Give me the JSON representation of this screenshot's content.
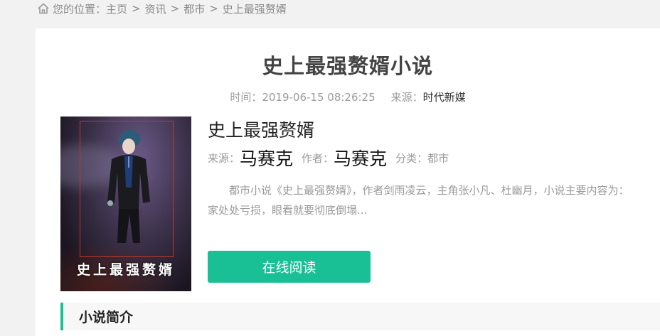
{
  "breadcrumb": {
    "icon": "home-icon",
    "prefix": "您的位置：",
    "items": [
      "主页",
      "资讯",
      "都市",
      "史上最强赘婿"
    ],
    "separator": ">"
  },
  "article": {
    "title": "史上最强赘婿小说",
    "time_label": "时间：",
    "time_value": "2019-06-15 08:26:25",
    "source_label": "来源：",
    "source_value": "时代新媒"
  },
  "book": {
    "cover_text": "史上最强赘婿",
    "name": "史上最强赘婿",
    "source_label": "来源：",
    "source_value": "马赛克",
    "author_label": "作者：",
    "author_value": "马赛克",
    "category_label": "分类：",
    "category_value": "都市",
    "description_line1": "都市小说《史上最强赘婿》，作者剑雨凌云，主角张小凡、杜幽月，小说主要内容为：",
    "description_line2": "家处处亏损，眼看就要彻底倒塌...",
    "read_button": "在线阅读"
  },
  "section": {
    "title": "小说简介"
  },
  "colors": {
    "accent": "#19c095",
    "cover_frame": "#c0392b"
  }
}
